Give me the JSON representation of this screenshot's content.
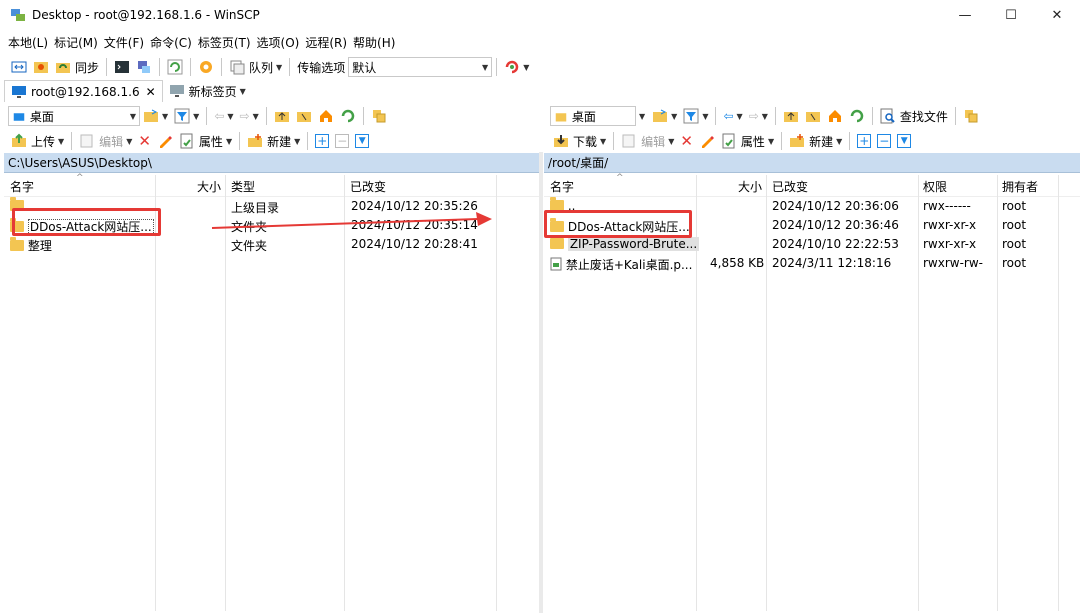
{
  "window": {
    "title": "Desktop - root@192.168.1.6 - WinSCP"
  },
  "menu": [
    "本地(L)",
    "标记(M)",
    "文件(F)",
    "命令(C)",
    "标签页(T)",
    "选项(O)",
    "远程(R)",
    "帮助(H)"
  ],
  "toolbar1": {
    "sync_label": "同步",
    "queue_label": "队列",
    "transfer_label": "传输选项",
    "transfer_value": "默认"
  },
  "tabs": [
    {
      "label": "root@192.168.1.6"
    },
    {
      "label": "新标签页"
    }
  ],
  "left": {
    "location": "桌面",
    "upload_label": "上传",
    "edit_label": "编辑",
    "props_label": "属性",
    "new_label": "新建",
    "path": "C:\\Users\\ASUS\\Desktop\\",
    "columns": {
      "name": "名字",
      "size": "大小",
      "type": "类型",
      "modified": "已改变"
    },
    "rows": [
      {
        "name": "..",
        "size": "",
        "type": "上级目录",
        "modified": "2024/10/12 20:35:26"
      },
      {
        "name": "DDos-Attack网站压...",
        "size": "",
        "type": "文件夹",
        "modified": "2024/10/12 20:35:14"
      },
      {
        "name": "整理",
        "size": "",
        "type": "文件夹",
        "modified": "2024/10/12 20:28:41"
      }
    ]
  },
  "right": {
    "location": "桌面",
    "find_label": "查找文件",
    "download_label": "下载",
    "edit_label": "编辑",
    "props_label": "属性",
    "new_label": "新建",
    "path": "/root/桌面/",
    "columns": {
      "name": "名字",
      "size": "大小",
      "modified": "已改变",
      "perm": "权限",
      "owner": "拥有者"
    },
    "rows": [
      {
        "name": "..",
        "size": "",
        "modified": "2024/10/12 20:36:06",
        "perm": "rwx------",
        "owner": "root"
      },
      {
        "name": "DDos-Attack网站压...",
        "size": "",
        "modified": "2024/10/12 20:36:46",
        "perm": "rwxr-xr-x",
        "owner": "root"
      },
      {
        "name": "ZIP-Password-Brute...",
        "size": "",
        "modified": "2024/10/10 22:22:53",
        "perm": "rwxr-xr-x",
        "owner": "root"
      },
      {
        "name": "禁止废话+Kali桌面.p...",
        "size": "4,858 KB",
        "modified": "2024/3/11 12:18:16",
        "perm": "rwxrw-rw-",
        "owner": "root"
      }
    ]
  },
  "colors": {
    "path_bar": "#c9dcf0",
    "folder": "#f3c552",
    "highlight": "#e53935",
    "accent": "#1e88e5"
  }
}
